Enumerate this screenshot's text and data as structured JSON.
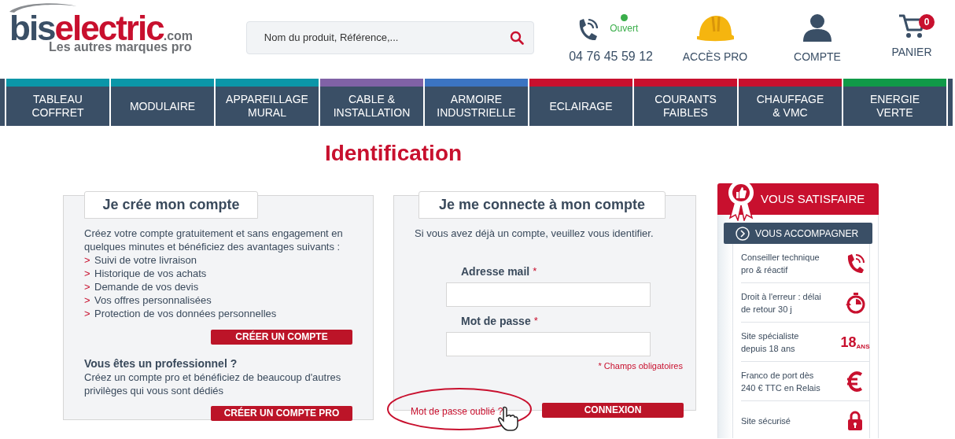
{
  "logo": {
    "part_1": "bis",
    "part_2": "electric",
    "part_3": ".com",
    "tagline": "Les autres marques pro"
  },
  "search": {
    "placeholder": "Nom du produit, Référence,..."
  },
  "contact": {
    "status": "Ouvert",
    "open": true,
    "phone": "04 76 45 59 12"
  },
  "header_links": [
    {
      "kind": "pro",
      "label": "ACCÈS PRO"
    },
    {
      "kind": "account",
      "label": "COMPTE"
    },
    {
      "kind": "cart",
      "label": "PANIER",
      "count": "0"
    }
  ],
  "categories": [
    {
      "lines": [
        "TABLEAU",
        "COFFRET"
      ],
      "color": "#0b96a8"
    },
    {
      "lines": [
        "MODULAIRE"
      ],
      "color": "#0b96a8"
    },
    {
      "lines": [
        "APPAREILLAGE",
        "MURAL"
      ],
      "color": "#0b96a8"
    },
    {
      "lines": [
        "CABLE &",
        "INSTALLATION"
      ],
      "color": "#8062a6"
    },
    {
      "lines": [
        "ARMOIRE",
        "INDUSTRIELLE"
      ],
      "color": "#3b74c2"
    },
    {
      "lines": [
        "ECLAIRAGE"
      ],
      "color": "#c8102e"
    },
    {
      "lines": [
        "COURANTS",
        "FAIBLES"
      ],
      "color": "#c8102e"
    },
    {
      "lines": [
        "CHAUFFAGE",
        "& VMC"
      ],
      "color": "#c8102e"
    },
    {
      "lines": [
        "ENERGIE",
        "VERTE"
      ],
      "color": "#109a48"
    }
  ],
  "page_title": "Identification",
  "create_panel": {
    "title": "Je crée mon compte",
    "intro": "Créez votre compte gratuitement et sans engagement en quelques minutes et bénéficiez des avantages suivants :",
    "benefits": [
      {
        "marker": ">",
        "text": "Suivi de votre livraison"
      },
      {
        "marker": ">",
        "text": "Historique de vos achats"
      },
      {
        "marker": ">",
        "text": "Demande de vos devis"
      },
      {
        "marker": ">",
        "text": "Vos offres personnalisées"
      },
      {
        "marker": ">",
        "text": "Protection de vos données personnelles"
      }
    ],
    "button": "CRÉER UN COMPTE",
    "pro_heading": "Vous êtes un professionnel ?",
    "pro_text": "Créez un compte pro et bénéficiez de beaucoup d'autres privilèges qui vous sont dédiés",
    "pro_button": "CRÉER UN COMPTE PRO"
  },
  "login_panel": {
    "title": "Je me connecte à mon compte",
    "intro": "Si vous avez déjà un compte, veuillez vous identifier.",
    "fields": [
      {
        "label": "Adresse mail",
        "required": "*"
      },
      {
        "label": "Mot de passe",
        "required": "*"
      }
    ],
    "required_note": "* Champs obligatoires",
    "forgot_link": "Mot de passe oublié ?",
    "forgot_circled": true,
    "button": "CONNEXION"
  },
  "sidebar": {
    "title": "VOUS SATISFAIRE",
    "subtitle": "VOUS ACCOMPAGNER",
    "items": [
      {
        "text": "Conseiller technique pro & réactif",
        "kind": "phone"
      },
      {
        "text": "Droit à l'erreur : délai de retour 30 j",
        "kind": "timer"
      },
      {
        "text": "Site spécialiste depuis 18 ans",
        "kind": "years",
        "number": "18",
        "unit": "ANS"
      },
      {
        "text": "Franco de port dès 240 € TTC en Relais",
        "kind": "euro"
      },
      {
        "text": "Site sécurisé",
        "kind": "lock"
      }
    ]
  }
}
